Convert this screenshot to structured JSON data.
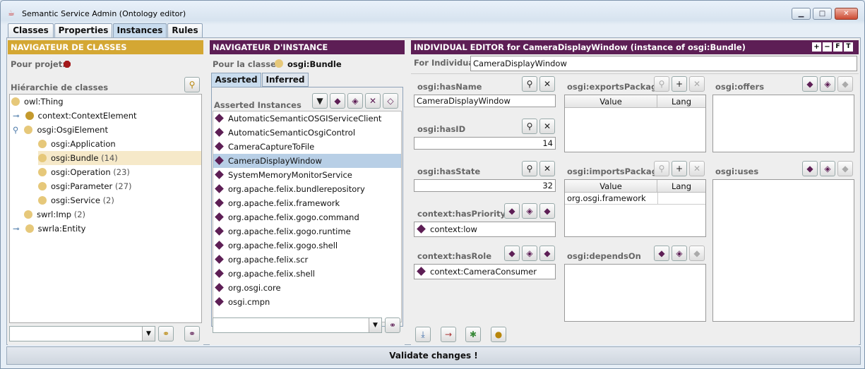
{
  "window": {
    "title": "Semantic Service Admin (Ontology editor)",
    "minimize": "▁",
    "maximize": "□",
    "close": "✕"
  },
  "tabs": [
    {
      "label": "Classes"
    },
    {
      "label": "Properties"
    },
    {
      "label": "Instances"
    },
    {
      "label": "Rules"
    }
  ],
  "class_nav": {
    "header": "NAVIGATEUR DE CLASSES",
    "project_label": "Pour projet:",
    "hierarchy_label": "Hiérarchie de classes",
    "items": [
      {
        "label": "owl:Thing",
        "count": ""
      },
      {
        "label": "context:ContextElement",
        "count": ""
      },
      {
        "label": "osgi:OsgiElement",
        "count": ""
      },
      {
        "label": "osgi:Application",
        "count": ""
      },
      {
        "label": "osgi:Bundle",
        "count": "(14)"
      },
      {
        "label": "osgi:Operation",
        "count": "(23)"
      },
      {
        "label": "osgi:Parameter",
        "count": "(27)"
      },
      {
        "label": "osgi:Service",
        "count": "(2)"
      },
      {
        "label": "swrl:Imp",
        "count": "(2)"
      },
      {
        "label": "swrla:Entity",
        "count": ""
      }
    ]
  },
  "instance_nav": {
    "header": "NAVIGATEUR D'INSTANCE",
    "class_label": "Pour la classe:",
    "class_value": "osgi:Bundle",
    "tab_asserted": "Asserted",
    "tab_inferred": "Inferred",
    "list_label": "Asserted Instances",
    "items": [
      "AutomaticSemanticOSGIServiceClient",
      "AutomaticSemanticOsgiControl",
      "CameraCaptureToFile",
      "CameraDisplayWindow",
      "SystemMemoryMonitorService",
      "org.apache.felix.bundlerepository",
      "org.apache.felix.framework",
      "org.apache.felix.gogo.command",
      "org.apache.felix.gogo.runtime",
      "org.apache.felix.gogo.shell",
      "org.apache.felix.scr",
      "org.apache.felix.shell",
      "org.osgi.core",
      "osgi.cmpn"
    ]
  },
  "editor": {
    "header": "INDIVIDUAL EDITOR for CameraDisplayWindow   (instance of osgi:Bundle)",
    "for_label": "For Individual:",
    "for_value": "CameraDisplayWindow",
    "hasName": {
      "label": "osgi:hasName",
      "value": "CameraDisplayWindow"
    },
    "hasID": {
      "label": "osgi:hasID",
      "value": "14"
    },
    "hasState": {
      "label": "osgi:hasState",
      "value": "32"
    },
    "hasPriority": {
      "label": "context:hasPriority",
      "value": "context:low"
    },
    "hasRole": {
      "label": "context:hasRole",
      "value": "context:CameraConsumer"
    },
    "exportsPackage": {
      "label": "osgi:exportsPackage",
      "col_value": "Value",
      "col_lang": "Lang"
    },
    "importsPackage": {
      "label": "osgi:importsPackage",
      "col_value": "Value",
      "col_lang": "Lang",
      "row_value": "org.osgi.framework"
    },
    "dependsOn": {
      "label": "osgi:dependsOn"
    },
    "offers": {
      "label": "osgi:offers"
    },
    "uses": {
      "label": "osgi:uses"
    }
  },
  "status": {
    "label": "Validate changes !"
  },
  "colors": {
    "gold": "#d4a733",
    "purple": "#5d1e55",
    "selection": "#b8cfe6"
  }
}
